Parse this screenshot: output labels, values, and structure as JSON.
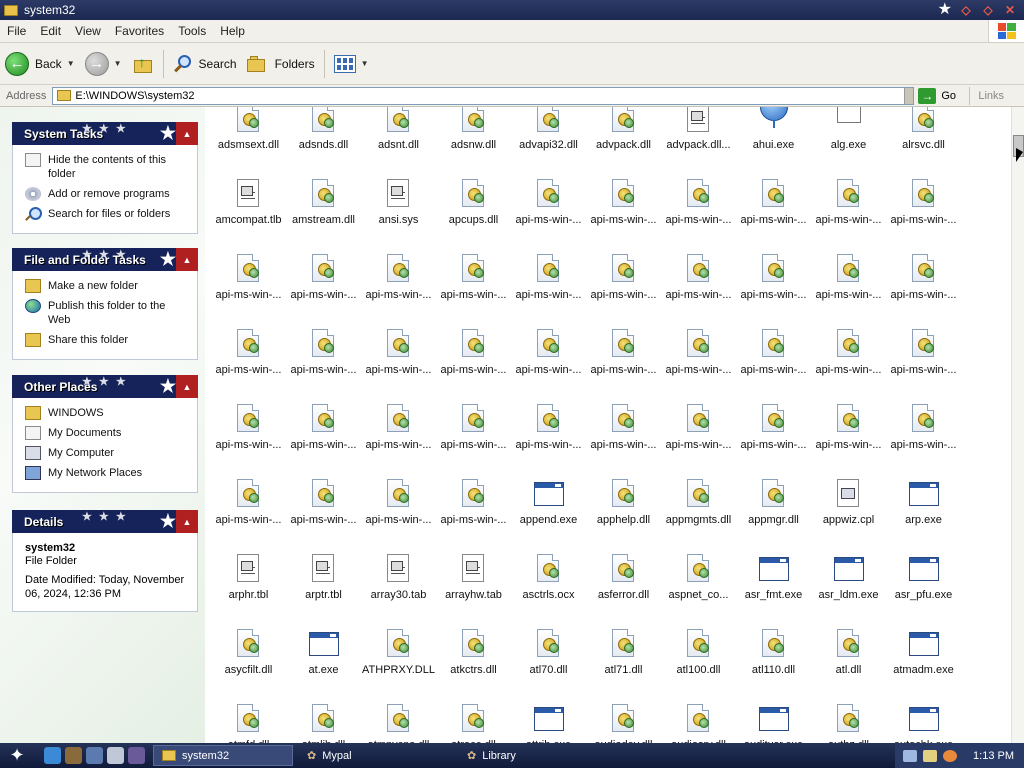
{
  "window": {
    "title": "system32"
  },
  "menu": [
    "File",
    "Edit",
    "View",
    "Favorites",
    "Tools",
    "Help"
  ],
  "toolbar": {
    "back": "Back",
    "search": "Search",
    "folders": "Folders"
  },
  "address": {
    "label": "Address",
    "path": "E:\\WINDOWS\\system32",
    "go": "Go",
    "links": "Links"
  },
  "panels": {
    "system_tasks": {
      "title": "System Tasks",
      "items": [
        {
          "label": "Hide the contents of this folder",
          "icon": "document-icon"
        },
        {
          "label": "Add or remove programs",
          "icon": "cd-icon"
        },
        {
          "label": "Search for files or folders",
          "icon": "search-icon"
        }
      ]
    },
    "file_tasks": {
      "title": "File and Folder Tasks",
      "items": [
        {
          "label": "Make a new folder",
          "icon": "folder-icon"
        },
        {
          "label": "Publish this folder to the Web",
          "icon": "globe-icon"
        },
        {
          "label": "Share this folder",
          "icon": "share-folder-icon"
        }
      ]
    },
    "other_places": {
      "title": "Other Places",
      "items": [
        {
          "label": "WINDOWS",
          "icon": "folder-icon"
        },
        {
          "label": "My Documents",
          "icon": "documents-icon"
        },
        {
          "label": "My Computer",
          "icon": "computer-icon"
        },
        {
          "label": "My Network Places",
          "icon": "network-icon"
        }
      ]
    },
    "details": {
      "title": "Details",
      "name": "system32",
      "type": "File Folder",
      "modified": "Date Modified: Today, November 06, 2024, 12:36 PM"
    }
  },
  "files": [
    {
      "name": "adsmsext.dll",
      "type": "dll"
    },
    {
      "name": "adsnds.dll",
      "type": "dll"
    },
    {
      "name": "adsnt.dll",
      "type": "dll"
    },
    {
      "name": "adsnw.dll",
      "type": "dll"
    },
    {
      "name": "advapi32.dll",
      "type": "dll"
    },
    {
      "name": "advpack.dll",
      "type": "dll"
    },
    {
      "name": "advpack.dll...",
      "type": "txt"
    },
    {
      "name": "ahui.exe",
      "type": "ahui"
    },
    {
      "name": "alg.exe",
      "type": "alg"
    },
    {
      "name": "alrsvc.dll",
      "type": "dll"
    },
    {
      "name": "amcompat.tlb",
      "type": "txt"
    },
    {
      "name": "amstream.dll",
      "type": "dll"
    },
    {
      "name": "ansi.sys",
      "type": "txt"
    },
    {
      "name": "apcups.dll",
      "type": "dll"
    },
    {
      "name": "api-ms-win-...",
      "type": "dll"
    },
    {
      "name": "api-ms-win-...",
      "type": "dll"
    },
    {
      "name": "api-ms-win-...",
      "type": "dll"
    },
    {
      "name": "api-ms-win-...",
      "type": "dll"
    },
    {
      "name": "api-ms-win-...",
      "type": "dll"
    },
    {
      "name": "api-ms-win-...",
      "type": "dll"
    },
    {
      "name": "api-ms-win-...",
      "type": "dll"
    },
    {
      "name": "api-ms-win-...",
      "type": "dll"
    },
    {
      "name": "api-ms-win-...",
      "type": "dll"
    },
    {
      "name": "api-ms-win-...",
      "type": "dll"
    },
    {
      "name": "api-ms-win-...",
      "type": "dll"
    },
    {
      "name": "api-ms-win-...",
      "type": "dll"
    },
    {
      "name": "api-ms-win-...",
      "type": "dll"
    },
    {
      "name": "api-ms-win-...",
      "type": "dll"
    },
    {
      "name": "api-ms-win-...",
      "type": "dll"
    },
    {
      "name": "api-ms-win-...",
      "type": "dll"
    },
    {
      "name": "api-ms-win-...",
      "type": "dll"
    },
    {
      "name": "api-ms-win-...",
      "type": "dll"
    },
    {
      "name": "api-ms-win-...",
      "type": "dll"
    },
    {
      "name": "api-ms-win-...",
      "type": "dll"
    },
    {
      "name": "api-ms-win-...",
      "type": "dll"
    },
    {
      "name": "api-ms-win-...",
      "type": "dll"
    },
    {
      "name": "api-ms-win-...",
      "type": "dll"
    },
    {
      "name": "api-ms-win-...",
      "type": "dll"
    },
    {
      "name": "api-ms-win-...",
      "type": "dll"
    },
    {
      "name": "api-ms-win-...",
      "type": "dll"
    },
    {
      "name": "api-ms-win-...",
      "type": "dll"
    },
    {
      "name": "api-ms-win-...",
      "type": "dll"
    },
    {
      "name": "api-ms-win-...",
      "type": "dll"
    },
    {
      "name": "api-ms-win-...",
      "type": "dll"
    },
    {
      "name": "api-ms-win-...",
      "type": "dll"
    },
    {
      "name": "api-ms-win-...",
      "type": "dll"
    },
    {
      "name": "api-ms-win-...",
      "type": "dll"
    },
    {
      "name": "api-ms-win-...",
      "type": "dll"
    },
    {
      "name": "api-ms-win-...",
      "type": "dll"
    },
    {
      "name": "api-ms-win-...",
      "type": "dll"
    },
    {
      "name": "api-ms-win-...",
      "type": "dll"
    },
    {
      "name": "api-ms-win-...",
      "type": "dll"
    },
    {
      "name": "api-ms-win-...",
      "type": "dll"
    },
    {
      "name": "api-ms-win-...",
      "type": "dll"
    },
    {
      "name": "append.exe",
      "type": "exe"
    },
    {
      "name": "apphelp.dll",
      "type": "dll"
    },
    {
      "name": "appmgmts.dll",
      "type": "dll"
    },
    {
      "name": "appmgr.dll",
      "type": "dll"
    },
    {
      "name": "appwiz.cpl",
      "type": "cpl"
    },
    {
      "name": "arp.exe",
      "type": "exe"
    },
    {
      "name": "arphr.tbl",
      "type": "txt"
    },
    {
      "name": "arptr.tbl",
      "type": "txt"
    },
    {
      "name": "array30.tab",
      "type": "txt"
    },
    {
      "name": "arrayhw.tab",
      "type": "txt"
    },
    {
      "name": "asctrls.ocx",
      "type": "dll"
    },
    {
      "name": "asferror.dll",
      "type": "dll"
    },
    {
      "name": "aspnet_co...",
      "type": "dll"
    },
    {
      "name": "asr_fmt.exe",
      "type": "exe"
    },
    {
      "name": "asr_ldm.exe",
      "type": "exe"
    },
    {
      "name": "asr_pfu.exe",
      "type": "exe"
    },
    {
      "name": "asycfilt.dll",
      "type": "dll"
    },
    {
      "name": "at.exe",
      "type": "exe"
    },
    {
      "name": "ATHPRXY.DLL",
      "type": "dll"
    },
    {
      "name": "atkctrs.dll",
      "type": "dll"
    },
    {
      "name": "atl70.dll",
      "type": "dll"
    },
    {
      "name": "atl71.dll",
      "type": "dll"
    },
    {
      "name": "atl100.dll",
      "type": "dll"
    },
    {
      "name": "atl110.dll",
      "type": "dll"
    },
    {
      "name": "atl.dll",
      "type": "dll"
    },
    {
      "name": "atmadm.exe",
      "type": "exe"
    },
    {
      "name": "atmfd.dll",
      "type": "dll"
    },
    {
      "name": "atmlib.dll",
      "type": "dll"
    },
    {
      "name": "atmpvcno.dll",
      "type": "dll"
    },
    {
      "name": "atrace.dll",
      "type": "dll"
    },
    {
      "name": "attrib.exe",
      "type": "exe"
    },
    {
      "name": "audiodev.dll",
      "type": "dll"
    },
    {
      "name": "audiosrv.dll",
      "type": "dll"
    },
    {
      "name": "auditusr.exe",
      "type": "exe"
    },
    {
      "name": "authz.dll",
      "type": "dll"
    },
    {
      "name": "autochk.exe",
      "type": "exe"
    }
  ],
  "taskbar": {
    "buttons": [
      {
        "label": "system32",
        "active": true
      },
      {
        "label": "Mypal",
        "active": false
      },
      {
        "label": "Library",
        "active": false
      }
    ],
    "clock": "1:13 PM"
  }
}
